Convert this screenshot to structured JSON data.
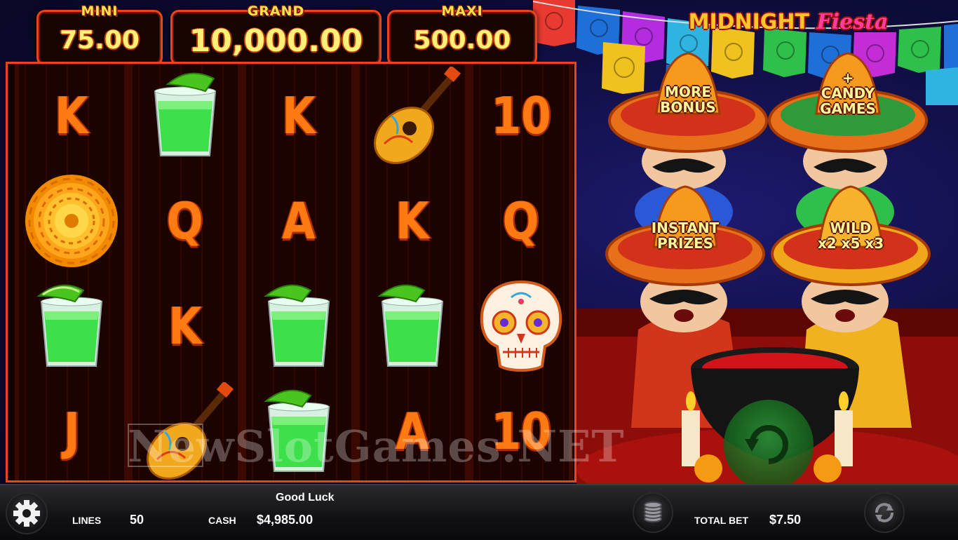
{
  "jackpots": {
    "mini": {
      "label": "MINI",
      "value": "75.00"
    },
    "grand": {
      "label": "GRAND",
      "value": "10,000.00"
    },
    "maxi": {
      "label": "MAXI",
      "value": "500.00"
    }
  },
  "title": {
    "part1": "MIDNIGHT ",
    "part2": "Fiesta"
  },
  "features": {
    "more_bonus": "MORE\nBONUS",
    "candy_games": "+\nCANDY\nGAMES",
    "instant_prizes": "INSTANT\nPRIZES",
    "wild": "WILD\nx2 x5 x3"
  },
  "reels": [
    [
      "K",
      "marigold-icon",
      "tequila-icon",
      "J"
    ],
    [
      "tequila-icon",
      "Q",
      "K",
      "guitar-icon"
    ],
    [
      "K",
      "A",
      "tequila-icon",
      "tequila-icon"
    ],
    [
      "guitar-icon",
      "K",
      "tequila-icon",
      "A"
    ],
    [
      "10",
      "Q",
      "sugar-skull-icon",
      "10"
    ]
  ],
  "status": {
    "message": "Good Luck"
  },
  "lines": {
    "label": "LINES",
    "value": "50"
  },
  "cash": {
    "label": "CASH",
    "value": "$4,985.00"
  },
  "total_bet": {
    "label": "TOTAL BET",
    "value": "$7.50"
  },
  "watermark": "NewSlotGames.NET",
  "colors": {
    "frame": "#e8451b",
    "letter": "#ff7a12",
    "jackpot_text": "#fff07a"
  }
}
